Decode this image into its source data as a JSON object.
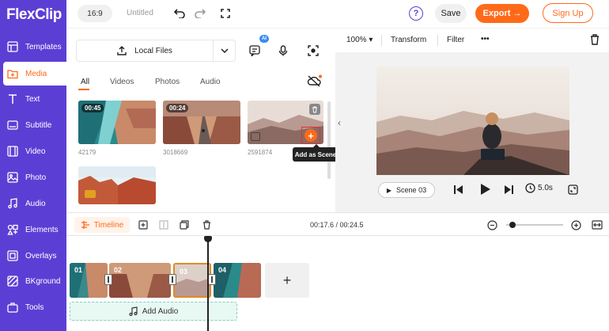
{
  "brand": {
    "logo": "FlexClip",
    "accent": "#ff6a1a",
    "sidebar_bg": "#5b3fd4"
  },
  "sidebar": {
    "items": [
      {
        "label": "Templates",
        "icon": "templates-icon"
      },
      {
        "label": "Media",
        "icon": "media-folder-icon",
        "active": true
      },
      {
        "label": "Text",
        "icon": "text-icon"
      },
      {
        "label": "Subtitle",
        "icon": "subtitle-icon"
      },
      {
        "label": "Video",
        "icon": "video-icon"
      },
      {
        "label": "Photo",
        "icon": "photo-icon"
      },
      {
        "label": "Audio",
        "icon": "music-note-icon"
      },
      {
        "label": "Elements",
        "icon": "elements-icon"
      },
      {
        "label": "Overlays",
        "icon": "overlays-icon"
      },
      {
        "label": "BKground",
        "icon": "background-icon"
      },
      {
        "label": "Tools",
        "icon": "tools-icon"
      }
    ]
  },
  "topbar": {
    "ratio": "16:9",
    "title": "Untitled",
    "help": "?",
    "save_label": "Save",
    "export_label": "Export →",
    "signup_label": "Sign Up"
  },
  "media": {
    "local_files_label": "Local Files",
    "ai_badge": "AI",
    "tabs": [
      "All",
      "Videos",
      "Photos",
      "Audio"
    ],
    "active_tab": "All",
    "items": [
      {
        "duration": "00:45",
        "id": "42179"
      },
      {
        "duration": "00:24",
        "id": "3018669"
      },
      {
        "duration": "",
        "id": "2591874"
      },
      {
        "duration": "",
        "id": ""
      }
    ],
    "tooltip": "Add as Scene"
  },
  "preview": {
    "zoom": "100%",
    "transform_label": "Transform",
    "filter_label": "Filter",
    "more_label": "•••",
    "scene_label": "Scene",
    "scene_number": "03",
    "duration": "5.0s"
  },
  "timeline": {
    "tab_label": "Timeline",
    "time": "00:17.6 / 00:24.5",
    "clips": [
      "01",
      "02",
      "03",
      "04"
    ],
    "add_clip": "+",
    "add_audio_label": "Add Audio",
    "zoom_level": 0.05
  }
}
